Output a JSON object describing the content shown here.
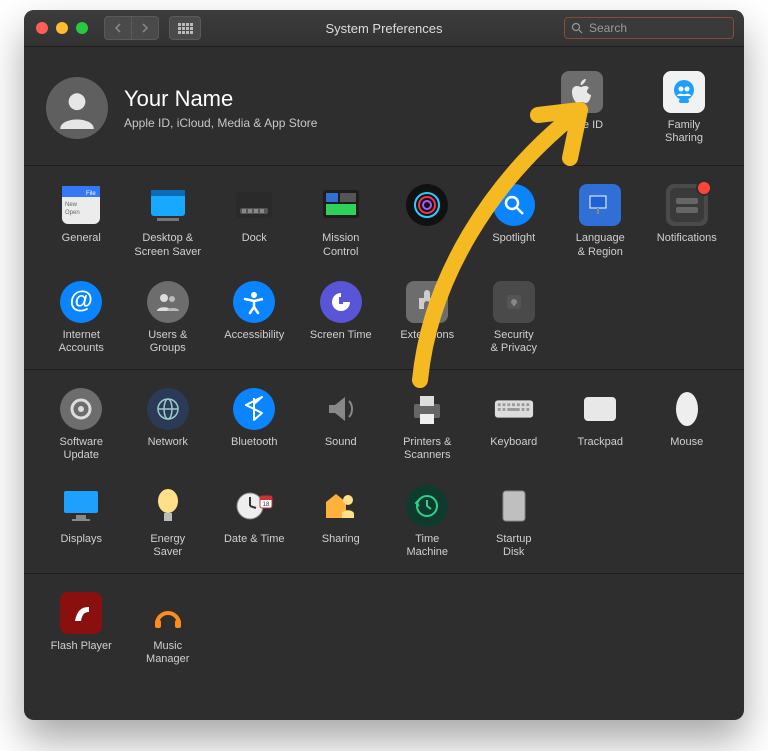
{
  "window": {
    "title": "System Preferences",
    "search_placeholder": "Search"
  },
  "user": {
    "name": "Your Name",
    "subtitle": "Apple ID, iCloud, Media & App Store"
  },
  "header_items": {
    "apple_id": "Apple ID",
    "family_sharing": "Family\nSharing"
  },
  "sections": [
    {
      "row1": {
        "general": "General",
        "desktop": "Desktop &\nScreen Saver",
        "dock": "Dock",
        "mission": "Mission\nControl",
        "siri": "",
        "spotlight": "Spotlight",
        "language": "Language\n& Region",
        "notifications": "Notifications"
      },
      "row2": {
        "internet": "Internet\nAccounts",
        "users": "Users &\nGroups",
        "accessibility": "Accessibility",
        "screentime": "Screen Time",
        "extensions": "Extensions",
        "security": "Security\n& Privacy"
      }
    },
    {
      "row1": {
        "software": "Software\nUpdate",
        "network": "Network",
        "bluetooth": "Bluetooth",
        "sound": "Sound",
        "printers": "Printers &\nScanners",
        "keyboard": "Keyboard",
        "trackpad": "Trackpad",
        "mouse": "Mouse"
      },
      "row2": {
        "displays": "Displays",
        "energy": "Energy\nSaver",
        "datetime": "Date & Time",
        "sharing": "Sharing",
        "timemachine": "Time\nMachine",
        "startup": "Startup\nDisk"
      }
    },
    {
      "row1": {
        "flash": "Flash Player",
        "music": "Music\nManager"
      }
    }
  ],
  "colors": {
    "accent": "#f5b921"
  }
}
